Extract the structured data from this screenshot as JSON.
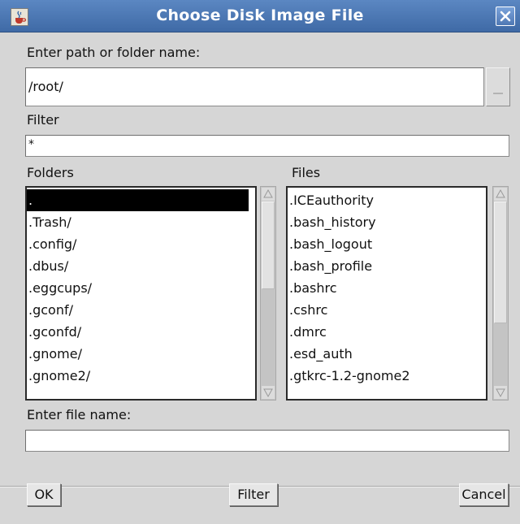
{
  "window": {
    "title": "Choose Disk Image File",
    "icon": "java-cup-icon",
    "close_icon": "close-icon"
  },
  "path": {
    "label": "Enter path or folder name:",
    "value": "/root/"
  },
  "filter": {
    "label": "Filter",
    "value": "*"
  },
  "folders": {
    "label": "Folders",
    "items": [
      ".",
      ".Trash/",
      ".config/",
      ".dbus/",
      ".eggcups/",
      ".gconf/",
      ".gconfd/",
      ".gnome/",
      ".gnome2/"
    ],
    "selected_index": 0
  },
  "files": {
    "label": "Files",
    "items": [
      ".ICEauthority",
      ".bash_history",
      ".bash_logout",
      ".bash_profile",
      ".bashrc",
      ".cshrc",
      ".dmrc",
      ".esd_auth",
      ".gtkrc-1.2-gnome2"
    ]
  },
  "filename": {
    "label": "Enter file name:",
    "value": ""
  },
  "buttons": {
    "ok": "OK",
    "filter": "Filter",
    "cancel": "Cancel"
  },
  "colors": {
    "titlebar": "#4a76b2",
    "dialog_bg": "#d6d6d6",
    "selection": "#000000"
  }
}
